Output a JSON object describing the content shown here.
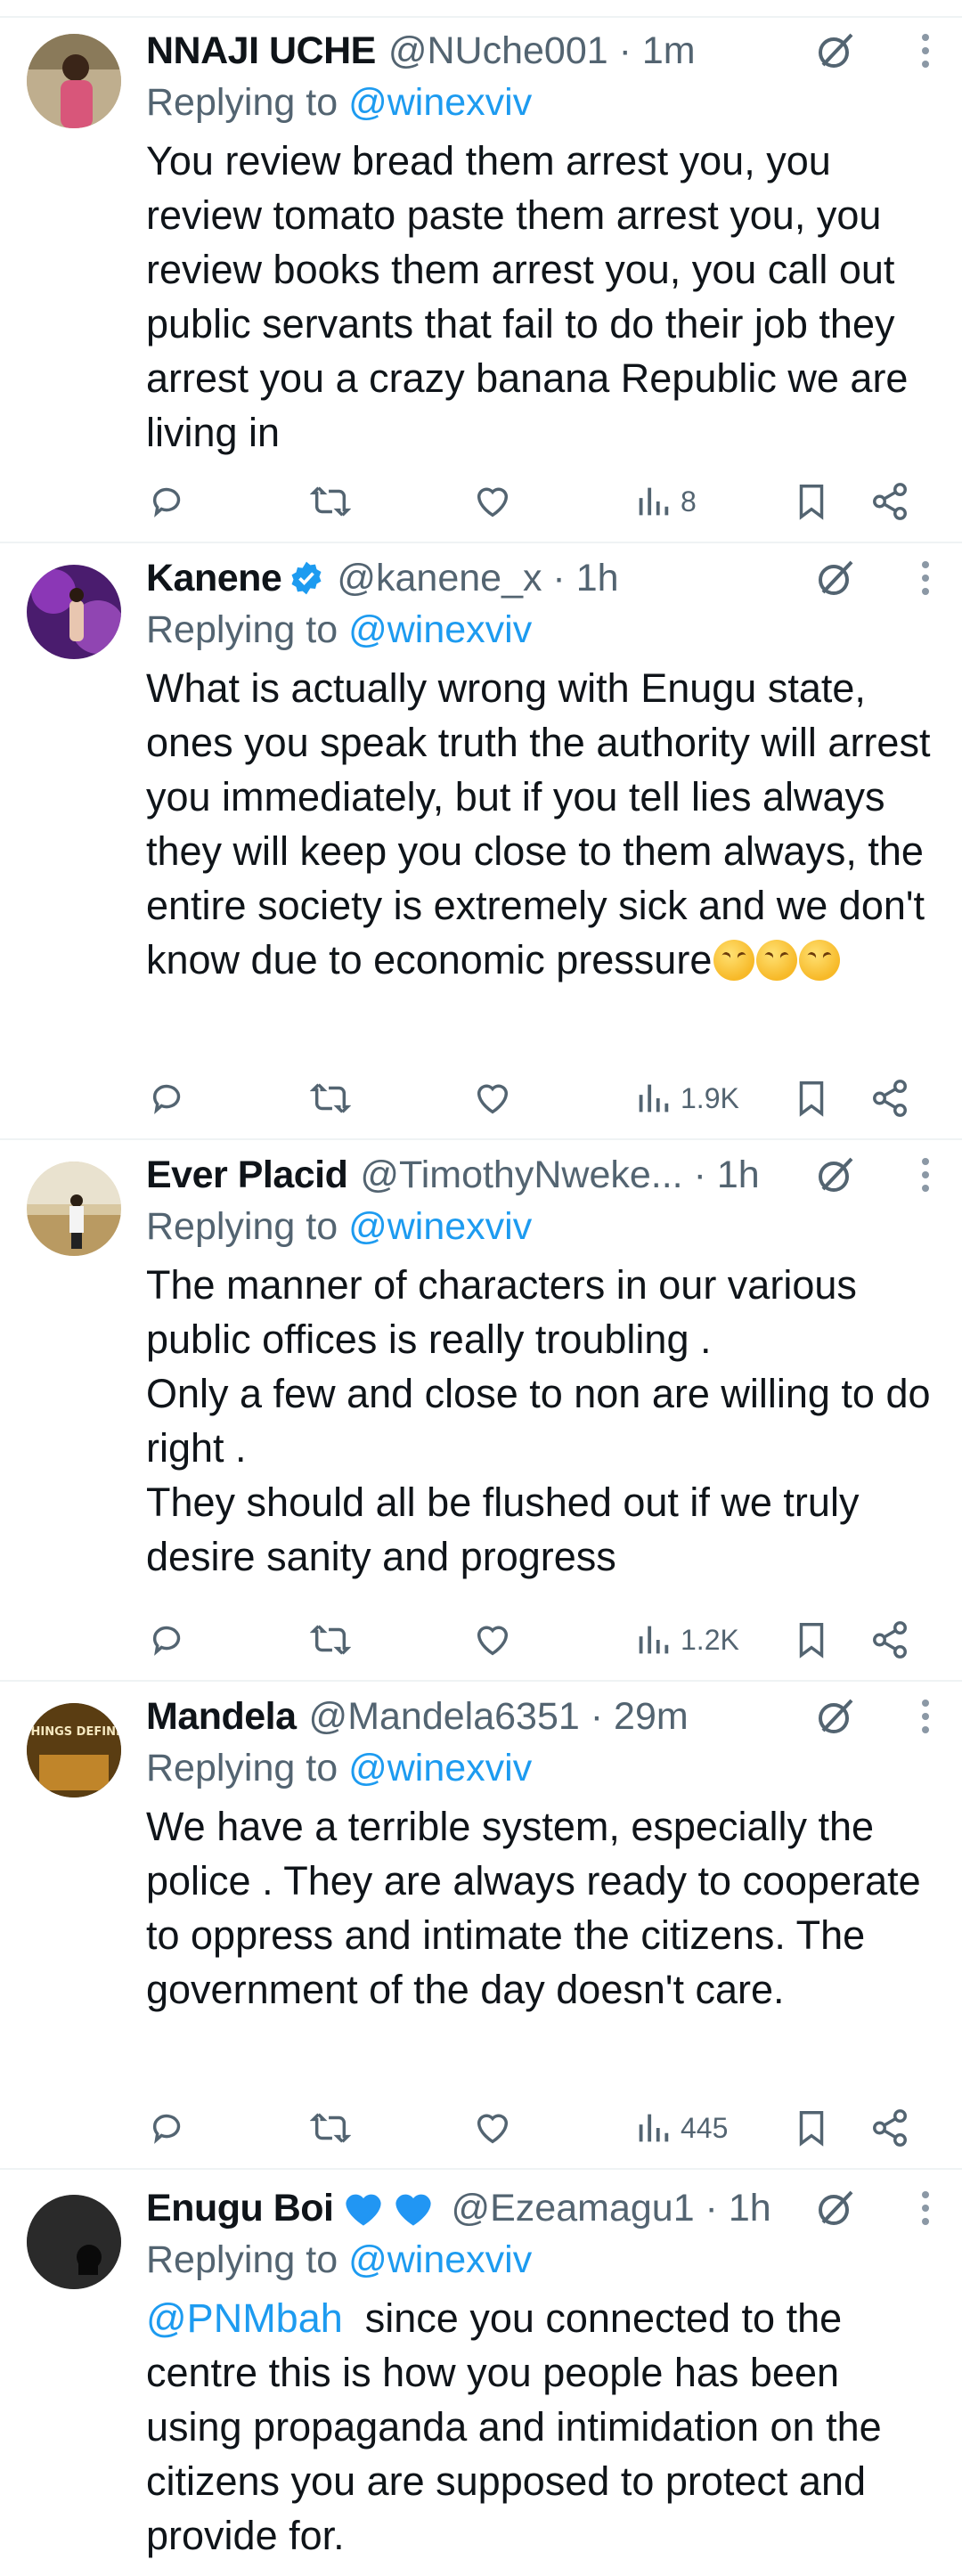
{
  "tweets": [
    {
      "name": "NNAJI UCHE",
      "handle": "@NUche001",
      "time": "1m",
      "reply_prefix": "Replying to",
      "reply_to": "@winexviv",
      "text": "You review bread them arrest you, you review tomato paste them arrest you, you review books them arrest you, you call out public servants that fail to do their job they arrest you a crazy banana Republic we are living in",
      "views": "8",
      "avatar_icon": "person-photo"
    },
    {
      "name": "Kanene",
      "verified": true,
      "handle": "@kanene_x",
      "time": "1h",
      "reply_prefix": "Replying to",
      "reply_to": "@winexviv",
      "text": "What is actually wrong with Enugu state, ones you speak truth the authority will arrest you immediately, but if you tell lies always they will keep you close to them always, the entire society is extremely sick and we don't know due to economic pressure",
      "emoji": "confounded-face x3",
      "views": "1.9K",
      "avatar_icon": "stage-photo"
    },
    {
      "name": "Ever Placid",
      "handle": "@TimothyNweke...",
      "time": "1h",
      "reply_prefix": "Replying to",
      "reply_to": "@winexviv",
      "text": "The manner of characters in our various public offices is really troubling .\nOnly a few and close to non are willing to do right .\nThey should all be flushed out if we truly desire sanity and progress",
      "views": "1.2K",
      "avatar_icon": "outdoor-photo"
    },
    {
      "name": "Mandela",
      "handle": "@Mandela6351",
      "time": "29m",
      "reply_prefix": "Replying to",
      "reply_to": "@winexviv",
      "text": "We have a terrible system, especially the police . They are always ready to cooperate to oppress and intimate the citizens. The government of the day doesn't care.",
      "views": "445",
      "avatar_icon": "two-things-define-you-book",
      "avatar_text": "TWO THINGS DEFINE YOU:"
    },
    {
      "name": "Enugu Boi",
      "handle": "@Ezeamagu1",
      "time": "1h",
      "reply_prefix": "Replying to",
      "reply_to": "@winexviv",
      "mention": "@PNMbah",
      "text": "  since you connected to the centre this is how you people has been using propaganda and intimidation on the citizens you are supposed to protect and provide for.",
      "avatar_icon": "dark-photo",
      "name_emoji": "blue-hearts"
    }
  ],
  "colors": {
    "accent": "#1d9bf0",
    "muted": "#536471",
    "text": "#0f1419",
    "divider": "#eff3f4"
  }
}
